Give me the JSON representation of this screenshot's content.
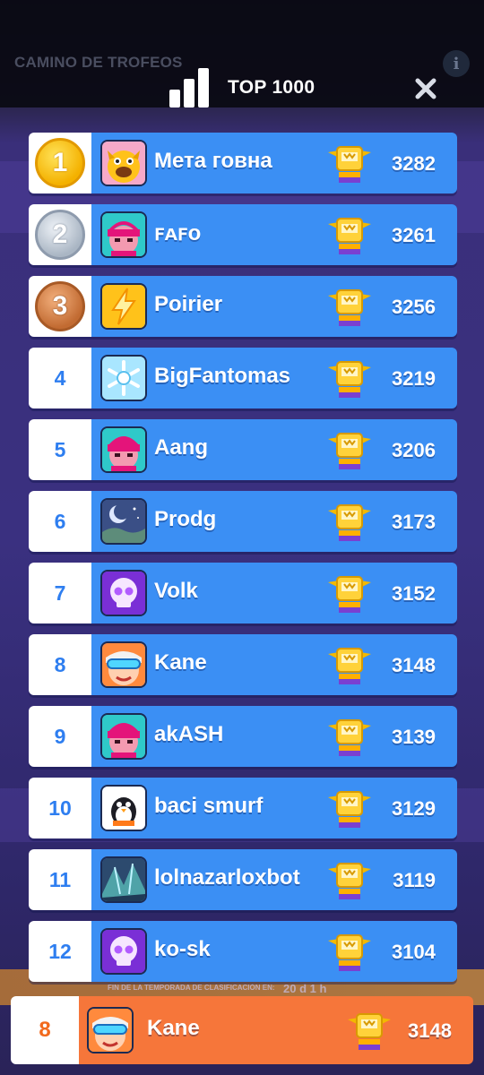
{
  "background": {
    "title": "CAMINO DE TROFEOS",
    "info_icon": "info-icon",
    "season_label": "FIN DE LA TEMPORADA DE CLASIFICACIÓN EN:",
    "season_time": "20 d 1 h"
  },
  "header": {
    "icon": "bar-chart-icon",
    "title": "TOP 1000",
    "close_icon": "close-icon"
  },
  "colors": {
    "row_blue": "#3b8ff4",
    "rank_text": "#2e7ef0",
    "own_row": "#f6763a",
    "gold": "#f4b100",
    "silver": "#aab6c4",
    "bronze": "#c26b32"
  },
  "rows": [
    {
      "rank": "1",
      "medal": "gold",
      "name": "Мета говна",
      "score": "3282",
      "avatar": "yellow-dog-avatar"
    },
    {
      "rank": "2",
      "medal": "silver",
      "name": "ꜰᴀꜰᴏ",
      "score": "3261",
      "avatar": "pink-hair-avatar"
    },
    {
      "rank": "3",
      "medal": "bronze",
      "name": "Poirier",
      "score": "3256",
      "avatar": "lightning-avatar"
    },
    {
      "rank": "4",
      "name": "BigFantomas",
      "score": "3219",
      "avatar": "snowflake-avatar"
    },
    {
      "rank": "5",
      "name": "Aang",
      "score": "3206",
      "avatar": "pink-hair-avatar"
    },
    {
      "rank": "6",
      "name": "Prodg",
      "score": "3173",
      "avatar": "night-moon-avatar"
    },
    {
      "rank": "7",
      "name": "Volk",
      "score": "3152",
      "avatar": "skull-avatar"
    },
    {
      "rank": "8",
      "name": "Kane",
      "score": "3148",
      "avatar": "goggles-avatar"
    },
    {
      "rank": "9",
      "name": "akASH",
      "score": "3139",
      "avatar": "pink-hair-avatar"
    },
    {
      "rank": "10",
      "name": "baci smurf",
      "score": "3129",
      "avatar": "penguin-avatar"
    },
    {
      "rank": "11",
      "name": "lolnazarloxbot",
      "score": "3119",
      "avatar": "crystal-avatar"
    },
    {
      "rank": "12",
      "name": "ko-sk",
      "score": "3104",
      "avatar": "skull-avatar"
    }
  ],
  "me": {
    "rank": "8",
    "name": "Kane",
    "score": "3148",
    "avatar": "goggles-avatar"
  },
  "trophy_icon": "trophy-icon"
}
